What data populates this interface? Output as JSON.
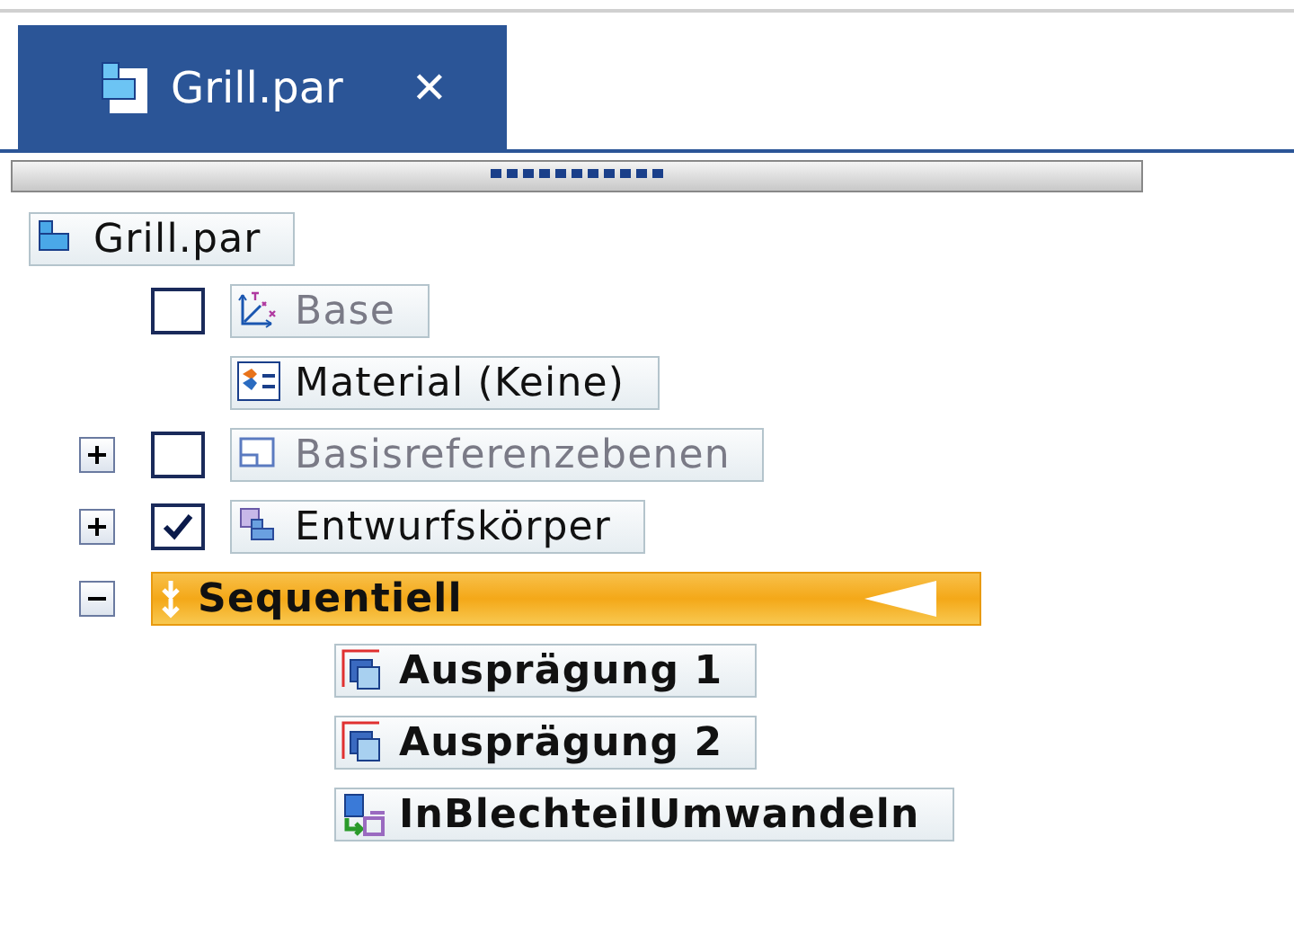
{
  "tab": {
    "title": "Grill.par",
    "close": "✕",
    "selected": true
  },
  "tree": {
    "label": "Grill.par",
    "kind": "part",
    "children": [
      {
        "label": "Base",
        "kind": "axes",
        "checked": false,
        "dim": true
      },
      {
        "label": "Material (Keine)",
        "kind": "material"
      },
      {
        "label": "Basisreferenzebenen",
        "kind": "plane",
        "checked": false,
        "dim": true,
        "expanded": false
      },
      {
        "label": "Entwurfskörper",
        "kind": "bodies",
        "checked": true,
        "expanded": false
      },
      {
        "label": "Sequentiell",
        "kind": "sequence",
        "bold": true,
        "selected": true,
        "expanded": true,
        "children": [
          {
            "label": "Ausprägung 1",
            "kind": "extrude",
            "bold": true
          },
          {
            "label": "Ausprägung 2",
            "kind": "extrude",
            "bold": true
          },
          {
            "label": "InBlechteilUmwandeln",
            "kind": "convert",
            "bold": true
          }
        ]
      }
    ]
  }
}
